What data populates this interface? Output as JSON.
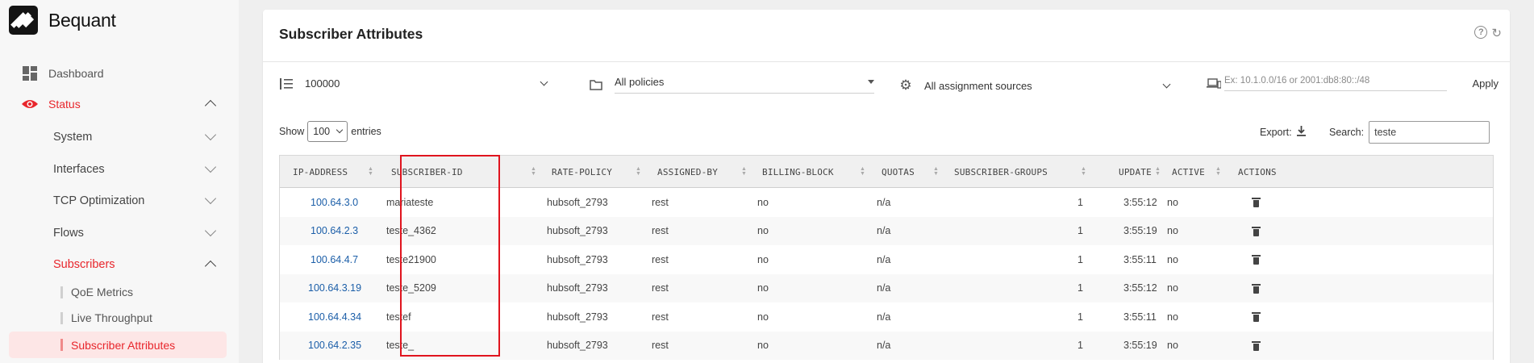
{
  "brand": {
    "name": "Bequant"
  },
  "sidebar": {
    "top": [
      {
        "label": "Dashboard",
        "icon": "dashboard-icon"
      },
      {
        "label": "Status",
        "icon": "eye-icon"
      }
    ],
    "sub": [
      {
        "label": "System"
      },
      {
        "label": "Interfaces"
      },
      {
        "label": "TCP Optimization"
      },
      {
        "label": "Flows"
      },
      {
        "label": "Subscribers"
      }
    ],
    "leaves": [
      {
        "label": "QoE Metrics"
      },
      {
        "label": "Live Throughput"
      },
      {
        "label": "Subscriber Attributes"
      }
    ]
  },
  "card": {
    "title": "Subscriber Attributes",
    "filters": {
      "limit": "100000",
      "policies": "All policies",
      "sources": "All assignment sources",
      "ip_placeholder": "Ex: 10.1.0.0/16 or 2001:db8:80::/48",
      "apply": "Apply"
    },
    "show_label": "Show",
    "page_size": "100",
    "entries_label": "entries",
    "export_label": "Export:",
    "search_label": "Search:",
    "search_value": "teste"
  },
  "table": {
    "headers": [
      "IP-ADDRESS",
      "SUBSCRIBER-ID",
      "RATE-POLICY",
      "ASSIGNED-BY",
      "BILLING-BLOCK",
      "QUOTAS",
      "SUBSCRIBER-GROUPS",
      "UPDATE",
      "ACTIVE",
      "ACTIONS"
    ],
    "rows": [
      {
        "ip": "100.64.3.0",
        "sid": "mariateste",
        "policy": "hubsoft_2793",
        "by": "rest",
        "billing": "no",
        "quotas": "n/a",
        "groups": "1",
        "update": "3:55:12",
        "active": "no"
      },
      {
        "ip": "100.64.2.3",
        "sid": "teste_4362",
        "policy": "hubsoft_2793",
        "by": "rest",
        "billing": "no",
        "quotas": "n/a",
        "groups": "1",
        "update": "3:55:19",
        "active": "no"
      },
      {
        "ip": "100.64.4.7",
        "sid": "teste21900",
        "policy": "hubsoft_2793",
        "by": "rest",
        "billing": "no",
        "quotas": "n/a",
        "groups": "1",
        "update": "3:55:11",
        "active": "no"
      },
      {
        "ip": "100.64.3.19",
        "sid": "teste_5209",
        "policy": "hubsoft_2793",
        "by": "rest",
        "billing": "no",
        "quotas": "n/a",
        "groups": "1",
        "update": "3:55:12",
        "active": "no"
      },
      {
        "ip": "100.64.4.34",
        "sid": "testef",
        "policy": "hubsoft_2793",
        "by": "rest",
        "billing": "no",
        "quotas": "n/a",
        "groups": "1",
        "update": "3:55:11",
        "active": "no"
      },
      {
        "ip": "100.64.2.35",
        "sid": "teste_",
        "policy": "hubsoft_2793",
        "by": "rest",
        "billing": "no",
        "quotas": "n/a",
        "groups": "1",
        "update": "3:55:19",
        "active": "no"
      }
    ]
  },
  "colors": {
    "accent": "#e8262c",
    "link": "#1b5ea8",
    "highlight": "#e0141e"
  }
}
